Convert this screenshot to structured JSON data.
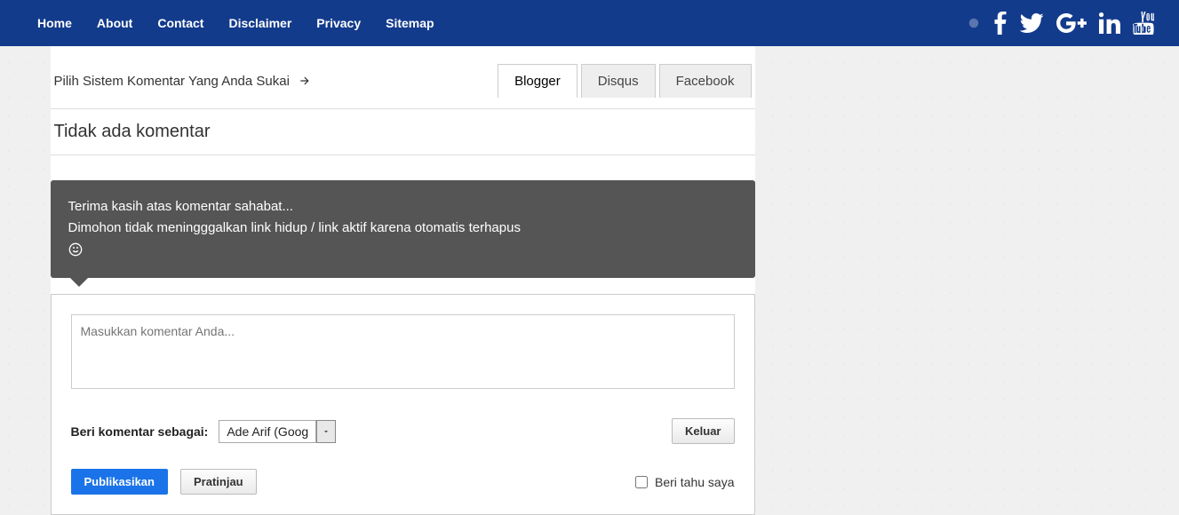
{
  "nav": {
    "home": "Home",
    "about": "About",
    "contact": "Contact",
    "disclaimer": "Disclaimer",
    "privacy": "Privacy",
    "sitemap": "Sitemap"
  },
  "picker_label": "Pilih Sistem Komentar Yang Anda Sukai",
  "tabs": {
    "blogger": "Blogger",
    "disqus": "Disqus",
    "facebook": "Facebook"
  },
  "no_comment": "Tidak ada komentar",
  "notice": {
    "l1": "Terima kasih atas komentar sahabat...",
    "l2": "Dimohon tidak meningggalkan link hidup / link aktif karena otomatis terhapus"
  },
  "comment_placeholder": "Masukkan komentar Anda...",
  "comment_as_label": "Beri komentar sebagai:",
  "comment_as_value": "Ade Arif (Goog",
  "logout": "Keluar",
  "publish": "Publikasikan",
  "preview": "Pratinjau",
  "notify": "Beri tahu saya"
}
